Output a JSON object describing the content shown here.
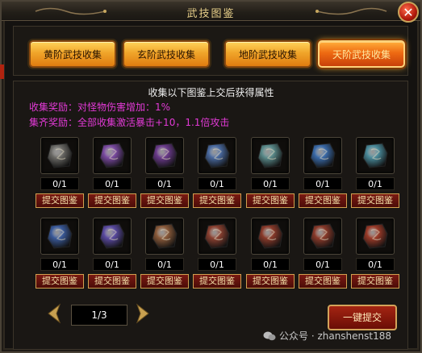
{
  "window": {
    "title": "武技图鉴",
    "close": "✕"
  },
  "tabs": [
    {
      "label": "黄阶武技收集",
      "active": false
    },
    {
      "label": "玄阶武技收集",
      "active": false
    },
    {
      "label": "地阶武技收集",
      "active": false
    },
    {
      "label": "天阶武技收集",
      "active": true
    }
  ],
  "info": {
    "headline": "收集以下图鉴上交后获得属性",
    "reward_line": "收集奖励：对怪物伤害增加：1%",
    "full_reward_line": "集齐奖励：全部收集激活暴击+10，1.1倍攻击"
  },
  "cards": [
    {
      "icon": "dark-rune-stone-icon",
      "color": "#6b6a66",
      "count": "0/1",
      "submit": "提交图鉴"
    },
    {
      "icon": "purple-crystal-icon",
      "color": "#7a4aa0",
      "count": "0/1",
      "submit": "提交图鉴"
    },
    {
      "icon": "violet-fire-gem-icon",
      "color": "#6a3a8a",
      "count": "0/1",
      "submit": "提交图鉴"
    },
    {
      "icon": "rainbow-gem-icon",
      "color": "#4a6aa0",
      "count": "0/1",
      "submit": "提交图鉴"
    },
    {
      "icon": "teal-ore-icon",
      "color": "#5a8a8a",
      "count": "0/1",
      "submit": "提交图鉴"
    },
    {
      "icon": "blue-crystal-icon",
      "color": "#3a6aa8",
      "count": "0/1",
      "submit": "提交图鉴"
    },
    {
      "icon": "cyan-stone-icon",
      "color": "#4a8a9a",
      "count": "0/1",
      "submit": "提交图鉴"
    },
    {
      "icon": "blue-ore-icon",
      "color": "#3a5a9a",
      "count": "0/1",
      "submit": "提交图鉴"
    },
    {
      "icon": "purple-stone-icon",
      "color": "#5a4aa0",
      "count": "0/1",
      "submit": "提交图鉴"
    },
    {
      "icon": "amber-crystal-icon",
      "color": "#8a5a3a",
      "count": "0/1",
      "submit": "提交图鉴"
    },
    {
      "icon": "red-rune-icon",
      "color": "#8a4030",
      "count": "0/1",
      "submit": "提交图鉴"
    },
    {
      "icon": "red-rune-icon",
      "color": "#8a3a2a",
      "count": "0/1",
      "submit": "提交图鉴"
    },
    {
      "icon": "crimson-rune-icon",
      "color": "#8a3a2a",
      "count": "0/1",
      "submit": "提交图鉴"
    },
    {
      "icon": "scarlet-rune-icon",
      "color": "#9a3a28",
      "count": "0/1",
      "submit": "提交图鉴"
    }
  ],
  "pager": {
    "page": "1/3"
  },
  "submit_all": "一键提交",
  "watermark": "公众号 · zhanshenst188"
}
